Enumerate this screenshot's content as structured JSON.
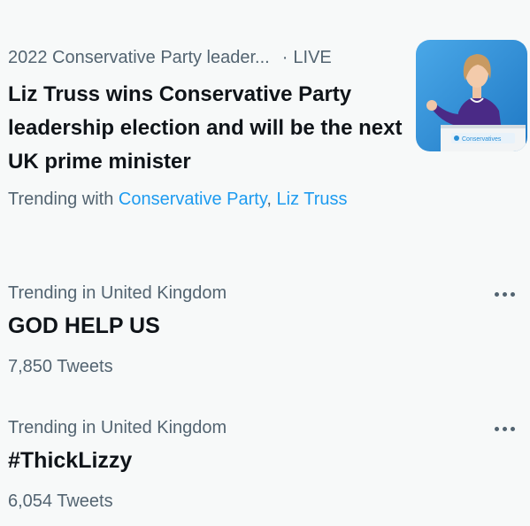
{
  "news": {
    "category": "2022 Conservative Party leader...",
    "separator": "·",
    "live_label": "LIVE",
    "headline": "Liz Truss wins Conservative Party leadership election and will be the next UK prime minister",
    "trending_prefix": "Trending with",
    "trending_links": [
      "Conservative Party",
      "Liz Truss"
    ],
    "trending_separator": ",",
    "thumbnail_caption": "Conservatives"
  },
  "trends": [
    {
      "context": "Trending in United Kingdom",
      "title": "GOD HELP US",
      "count": "7,850 Tweets"
    },
    {
      "context": "Trending in United Kingdom",
      "title": "#ThickLizzy",
      "count": "6,054 Tweets"
    }
  ],
  "colors": {
    "background": "#f7f9f9",
    "primary_text": "#0f1419",
    "secondary_text": "#536471",
    "link": "#1d9bf0",
    "photo_backdrop": "#2a8fd6",
    "outfit_purple": "#4a2a86"
  },
  "icons": {
    "more": "more-horizontal-icon"
  }
}
